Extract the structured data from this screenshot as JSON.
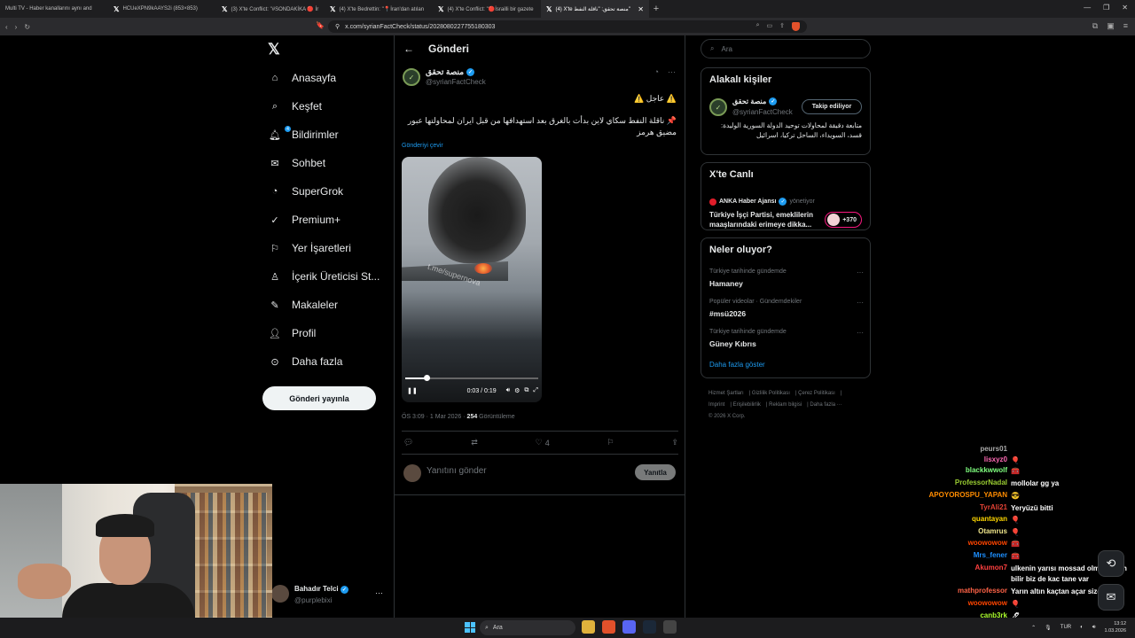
{
  "browser": {
    "tabs": [
      {
        "title": "Multi TV - Haber kanallarını aynı and"
      },
      {
        "title": "HCUeXPN9kAAYS2i (853×853)"
      },
      {
        "title": "(3) X'te Conflict: \"#SONDAKİKA 🔴 İr"
      },
      {
        "title": "(4) X'te Bedrettin: \"📍İran'dan atılan"
      },
      {
        "title": "(4) X'te Conflict: \"🔴İsrailli bir gazete"
      },
      {
        "title": "(4) X'te منصة تحقق: \"ناقلة النفط\""
      }
    ],
    "url": "x.com/syrianFactCheck/status/2028080227755180303"
  },
  "nav": {
    "items": [
      {
        "label": "Anasayfa",
        "icon": "home-icon"
      },
      {
        "label": "Keşfet",
        "icon": "search-icon"
      },
      {
        "label": "Bildirimler",
        "icon": "bell-icon",
        "badge": "4"
      },
      {
        "label": "Sohbet",
        "icon": "mail-icon"
      },
      {
        "label": "SuperGrok",
        "icon": "grok-icon"
      },
      {
        "label": "Premium+",
        "icon": "premium-icon"
      },
      {
        "label": "Yer İşaretleri",
        "icon": "bookmark-icon"
      },
      {
        "label": "İçerik Üreticisi St...",
        "icon": "creator-icon"
      },
      {
        "label": "Makaleler",
        "icon": "article-icon"
      },
      {
        "label": "Profil",
        "icon": "profile-icon"
      },
      {
        "label": "Daha fazla",
        "icon": "more-icon"
      }
    ],
    "post_button": "Gönderi yayınla"
  },
  "account": {
    "name": "Bahadır Telci",
    "handle": "@purplebixi"
  },
  "main": {
    "header_title": "Gönderi",
    "tweet": {
      "author_name": "منصة تحقق",
      "author_handle": "@syrianFactCheck",
      "line1": "⚠️ عاجل ⚠️",
      "text": "📌 ناقلة النفط سكاي لاين بدأت بالغرق بعد استهدافها من قبل ايران لمحاولتها عبور مضيق هرمز",
      "translate": "Gönderiyi çevir",
      "video_watermark": "t.me/supernova",
      "video_time": "0:03 / 0:19",
      "video_progress": 0.16,
      "meta_time": "ÖS 3:09 · 1 Mar 2026 · ",
      "meta_views": "254",
      "meta_views_label": " Görüntüleme",
      "likes": "4"
    },
    "reply_placeholder": "Yanıtını gönder",
    "reply_button": "Yanıtla"
  },
  "sidebar": {
    "search_placeholder": "Ara",
    "relevant": {
      "title": "Alakalı kişiler",
      "name": "منصة تحقق",
      "handle": "@syrianFactCheck",
      "follow_label": "Takip ediliyor",
      "bio": "متابعة دقيقة لمحاولات توحيد الدولة السورية الوليدة: قسد، السويداء، الساحل تركيا، اسرائيل"
    },
    "live": {
      "title": "X'te Canlı",
      "source": "ANKA Haber Ajansı",
      "source_role": "yönetiyor",
      "headline": "Türkiye İşçi Partisi, emeklilerin maaşlarındaki erimeye dikka...",
      "count": "+370"
    },
    "trends": {
      "title": "Neler oluyor?",
      "items": [
        {
          "context": "Türkiye tarihinde gündemde",
          "topic": "Hamaney"
        },
        {
          "context": "Popüler videolar · Gündemdekiler",
          "topic": "#msü2026"
        },
        {
          "context": "Türkiye tarihinde gündemde",
          "topic": "Güney Kıbrıs"
        }
      ],
      "show_more": "Daha fazla göster"
    },
    "footer": [
      "Hizmet Şartları",
      "Gizlilik Politikası",
      "Çerez Politikası",
      "Imprint",
      "Erişilebilirlik",
      "Reklam bilgisi",
      "Daha fazla ···",
      "© 2026 X Corp."
    ]
  },
  "chat": [
    {
      "user": "peurs01",
      "msg": "",
      "color": "#aaaaaa"
    },
    {
      "user": "lisxyz0",
      "msg": "🎈",
      "color": "#ff69b4"
    },
    {
      "user": "blackkwwolf",
      "msg": "🧰",
      "color": "#7fff7f"
    },
    {
      "user": "ProfessorNadal",
      "msg": "mollolar gg ya",
      "color": "#9acd32"
    },
    {
      "user": "APOYOROSPU_YAPAN",
      "msg": "😎",
      "color": "#ff8c00"
    },
    {
      "user": "TyrAli21",
      "msg": "Yeryüzü bitti",
      "color": "#e34234"
    },
    {
      "user": "quantayan",
      "msg": "🎈",
      "color": "#ffd700"
    },
    {
      "user": "Otamrus",
      "msg": "🎈",
      "color": "#f0e68c"
    },
    {
      "user": "woowowow",
      "msg": "🧰",
      "color": "#ff4500"
    },
    {
      "user": "Mrs_fener",
      "msg": "🧰",
      "color": "#1e90ff"
    },
    {
      "user": "Akumon7",
      "msg": "ulkenin yarısı mossad olmus Allah bilir biz de kac tane var",
      "color": "#ff4040"
    },
    {
      "user": "mathprofessor",
      "msg": "Yarın altın kaçtan açar sizce",
      "color": "#ff6347"
    },
    {
      "user": "woowowow",
      "msg": "🎈",
      "color": "#ff4500"
    },
    {
      "user": "canb3rk",
      "msg": "🖋",
      "color": "#adff2f"
    },
    {
      "user": "Apusikan31",
      "msg": "",
      "color": "#ff3030"
    }
  ],
  "taskbar": {
    "search_placeholder": "Ara",
    "lang": "TUR",
    "time": "13:12",
    "date": "1.03.2026"
  }
}
